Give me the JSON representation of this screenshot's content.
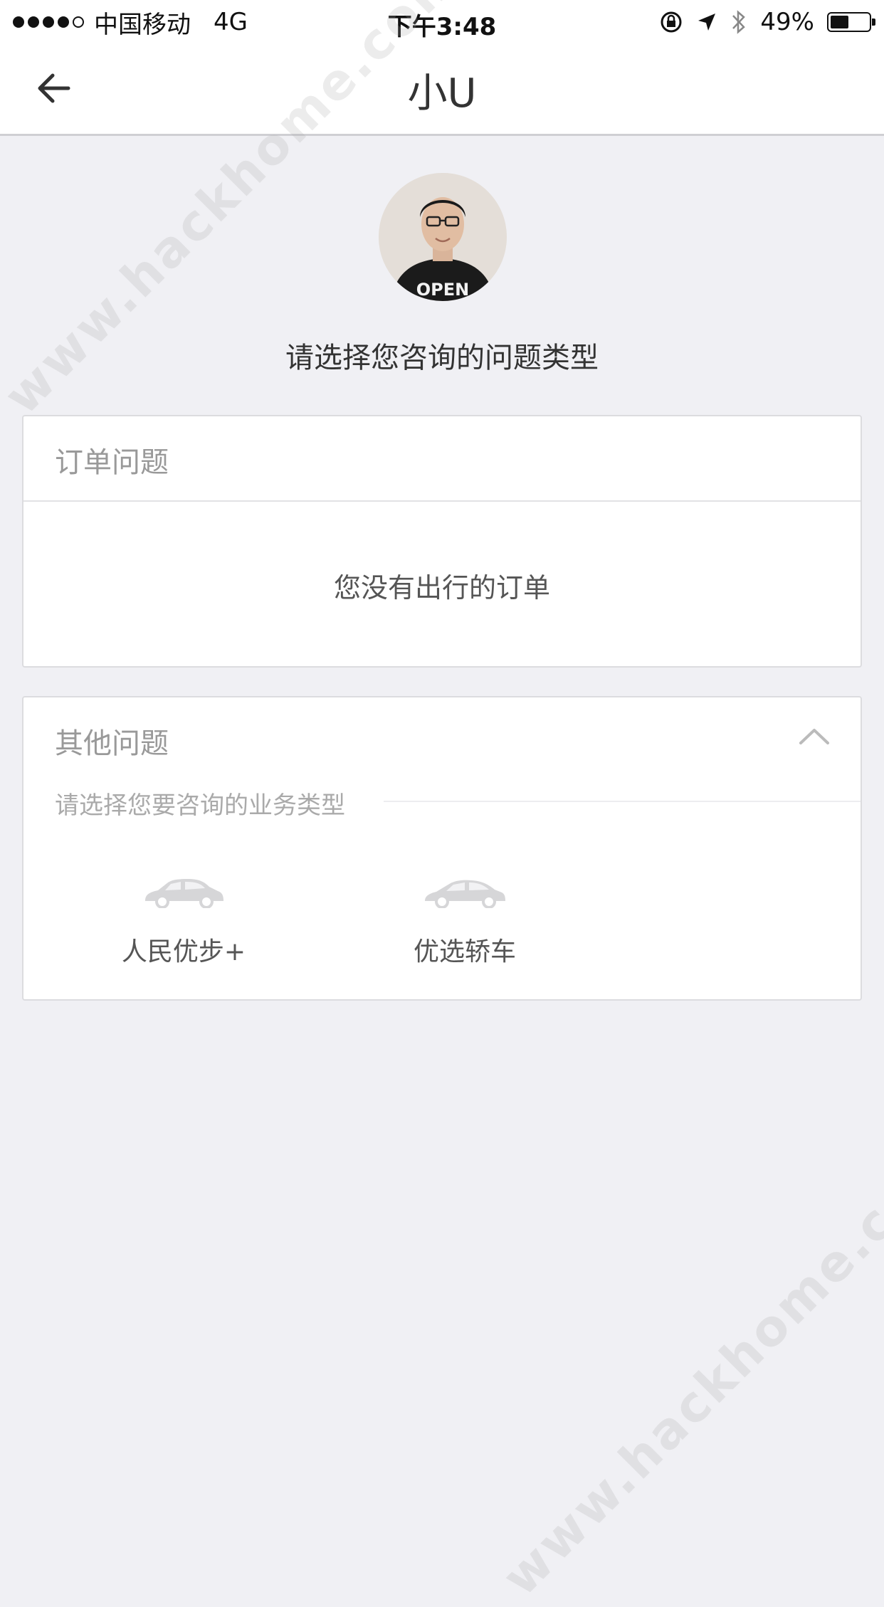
{
  "status_bar": {
    "carrier": "中国移动",
    "network": "4G",
    "time": "下午3:48",
    "battery_percent": "49%",
    "battery_level": 0.49
  },
  "nav": {
    "title": "小U",
    "back_icon": "arrow-left-icon"
  },
  "header": {
    "prompt": "请选择您咨询的问题类型"
  },
  "orders_card": {
    "title": "订单问题",
    "empty_message": "您没有出行的订单"
  },
  "other_card": {
    "title": "其他问题",
    "subtitle": "请选择您要咨询的业务类型",
    "services": [
      {
        "label": "人民优步+",
        "icon": "car-icon"
      },
      {
        "label": "优选轿车",
        "icon": "car-icon"
      }
    ]
  },
  "watermark": {
    "text": "www.hackhome.com"
  }
}
